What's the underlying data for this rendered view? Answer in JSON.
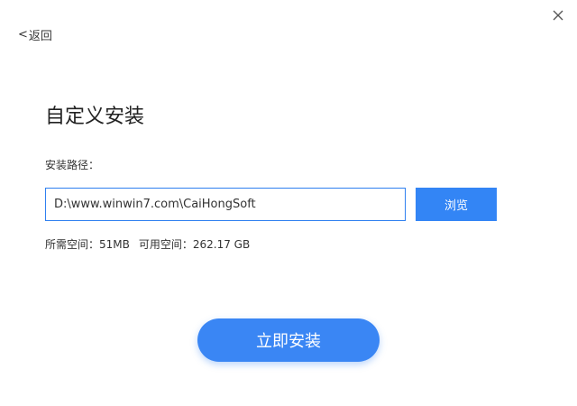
{
  "header": {
    "back_chevron": "<",
    "back_label": "返回",
    "close_icon": "close-icon"
  },
  "main": {
    "title": "自定义安装",
    "path_label": "安装路径：",
    "path_value": "D:\\www.winwin7.com\\CaiHongSoft",
    "browse_label": "浏览",
    "space_required": "所需空间：51MB",
    "space_available": "可用空间：262.17 GB",
    "install_label": "立即安装"
  },
  "colors": {
    "accent": "#3a86f4",
    "input_border": "#2f80f0",
    "text": "#333333"
  }
}
